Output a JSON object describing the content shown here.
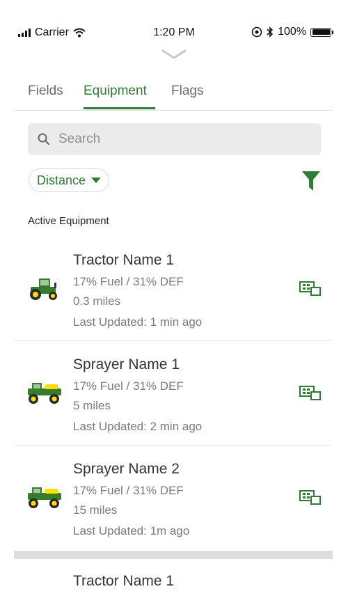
{
  "status_bar": {
    "carrier": "Carrier",
    "time": "1:20 PM",
    "battery": "100%"
  },
  "tabs": [
    {
      "label": "Fields",
      "active": false
    },
    {
      "label": "Equipment",
      "active": true
    },
    {
      "label": "Flags",
      "active": false
    }
  ],
  "search": {
    "placeholder": "Search",
    "value": ""
  },
  "sort": {
    "label": "Distance"
  },
  "section": {
    "title": "Active Equipment"
  },
  "equipment": [
    {
      "name": "Tractor Name 1",
      "fuel": "17% Fuel / 31% DEF",
      "distance": "0.3 miles",
      "updated": "Last Updated: 1 min ago",
      "type": "tractor"
    },
    {
      "name": "Sprayer Name 1",
      "fuel": "17% Fuel / 31% DEF",
      "distance": "5 miles",
      "updated": "Last Updated: 2 min ago",
      "type": "sprayer"
    },
    {
      "name": "Sprayer Name 2",
      "fuel": "17% Fuel / 31% DEF",
      "distance": "15 miles",
      "updated": "Last Updated: 1m ago",
      "type": "sprayer"
    }
  ],
  "partial_item": {
    "name": "Tractor Name 1"
  },
  "colors": {
    "accent": "#2e7d32",
    "equipment_green": "#367c2b",
    "equipment_yellow": "#ffde00"
  }
}
